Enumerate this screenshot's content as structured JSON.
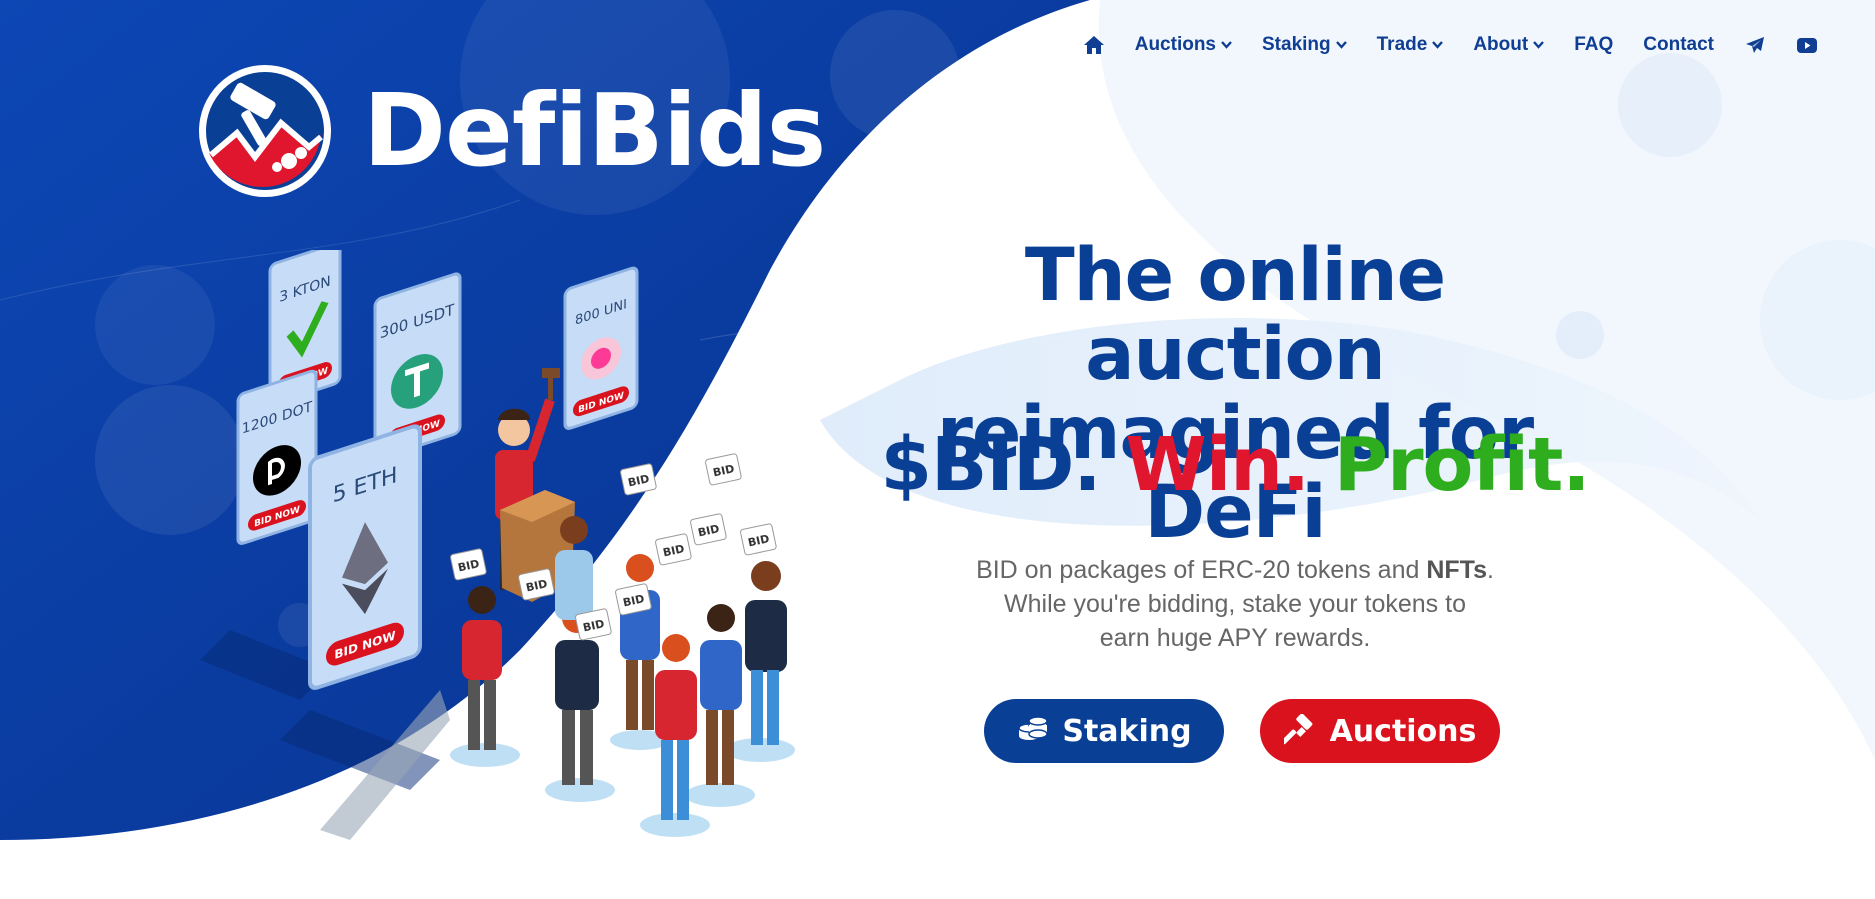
{
  "colors": {
    "brand_blue": "#0a3f96",
    "win_red": "#e0152e",
    "profit_green": "#2eae1e",
    "auction_red": "#d9121e",
    "nav_text": "#0f3e93"
  },
  "brand": {
    "name": "DefiBids",
    "logo_icon": "gavel-chart-logo"
  },
  "nav": {
    "home_icon": "home-icon",
    "items": [
      {
        "label": "Auctions",
        "has_dropdown": true
      },
      {
        "label": "Staking",
        "has_dropdown": true
      },
      {
        "label": "Trade",
        "has_dropdown": true
      },
      {
        "label": "About",
        "has_dropdown": true
      },
      {
        "label": "FAQ",
        "has_dropdown": false
      },
      {
        "label": "Contact",
        "has_dropdown": false
      }
    ],
    "telegram_icon": "telegram-icon",
    "youtube_icon": "youtube-icon"
  },
  "hero": {
    "headline_line1": "The online auction",
    "headline_line2": "reimagined for DeFi",
    "tagline_bid": "$BID.",
    "tagline_win": "Win.",
    "tagline_profit": "Profit.",
    "description_part1": "BID on packages of ERC-20 tokens and",
    "description_bold": "NFTs",
    "description_part2": ".",
    "description_line2": "While you're bidding, stake your tokens to",
    "description_line3": "earn huge APY rewards."
  },
  "buttons": {
    "staking_label": "Staking",
    "staking_icon": "coins-icon",
    "auctions_label": "Auctions",
    "auctions_icon": "gavel-icon"
  },
  "illustration": {
    "cards": [
      {
        "title": "3 KTON",
        "cta": "BID NOW",
        "icon": "kton-token-icon"
      },
      {
        "title": "300 USDT",
        "cta": "BID NOW",
        "icon": "tether-token-icon"
      },
      {
        "title": "800 UNI",
        "cta": "BID NOW",
        "icon": "uniswap-token-icon"
      },
      {
        "title": "1200 DOT",
        "cta": "BID NOW",
        "icon": "polkadot-token-icon"
      },
      {
        "title": "5 ETH",
        "cta": "BID NOW",
        "icon": "ethereum-token-icon"
      }
    ],
    "paddle_text": "BID"
  }
}
